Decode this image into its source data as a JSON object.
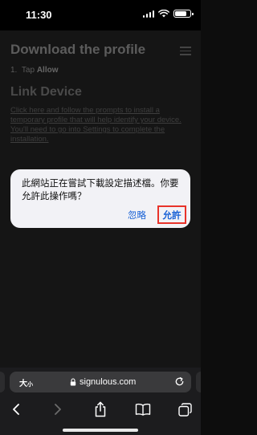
{
  "status_bar": {
    "time": "11:30",
    "battery_level": 0.8
  },
  "page": {
    "title": "Download the profile",
    "step_number": "1.",
    "step_prefix": "Tap",
    "step_action": "Allow",
    "section_title": "Link Device",
    "paragraph": "Click here and follow the prompts to install a temporary profile that will help identify your device. You'll need to go into Settings to complete the installation."
  },
  "alert": {
    "message": "此網站正在嘗試下載設定描述檔。你要允許此操作嗎？",
    "ignore_label": "忽略",
    "allow_label": "允許",
    "highlight_color": "#e8332a",
    "button_color": "#1a62d6"
  },
  "browser": {
    "text_size_label": "大",
    "text_size_small": "小",
    "url": "signulous.com",
    "icons": [
      "lock-icon",
      "reload-icon",
      "back-icon",
      "forward-icon",
      "share-icon",
      "bookmarks-icon",
      "tabs-icon"
    ]
  }
}
